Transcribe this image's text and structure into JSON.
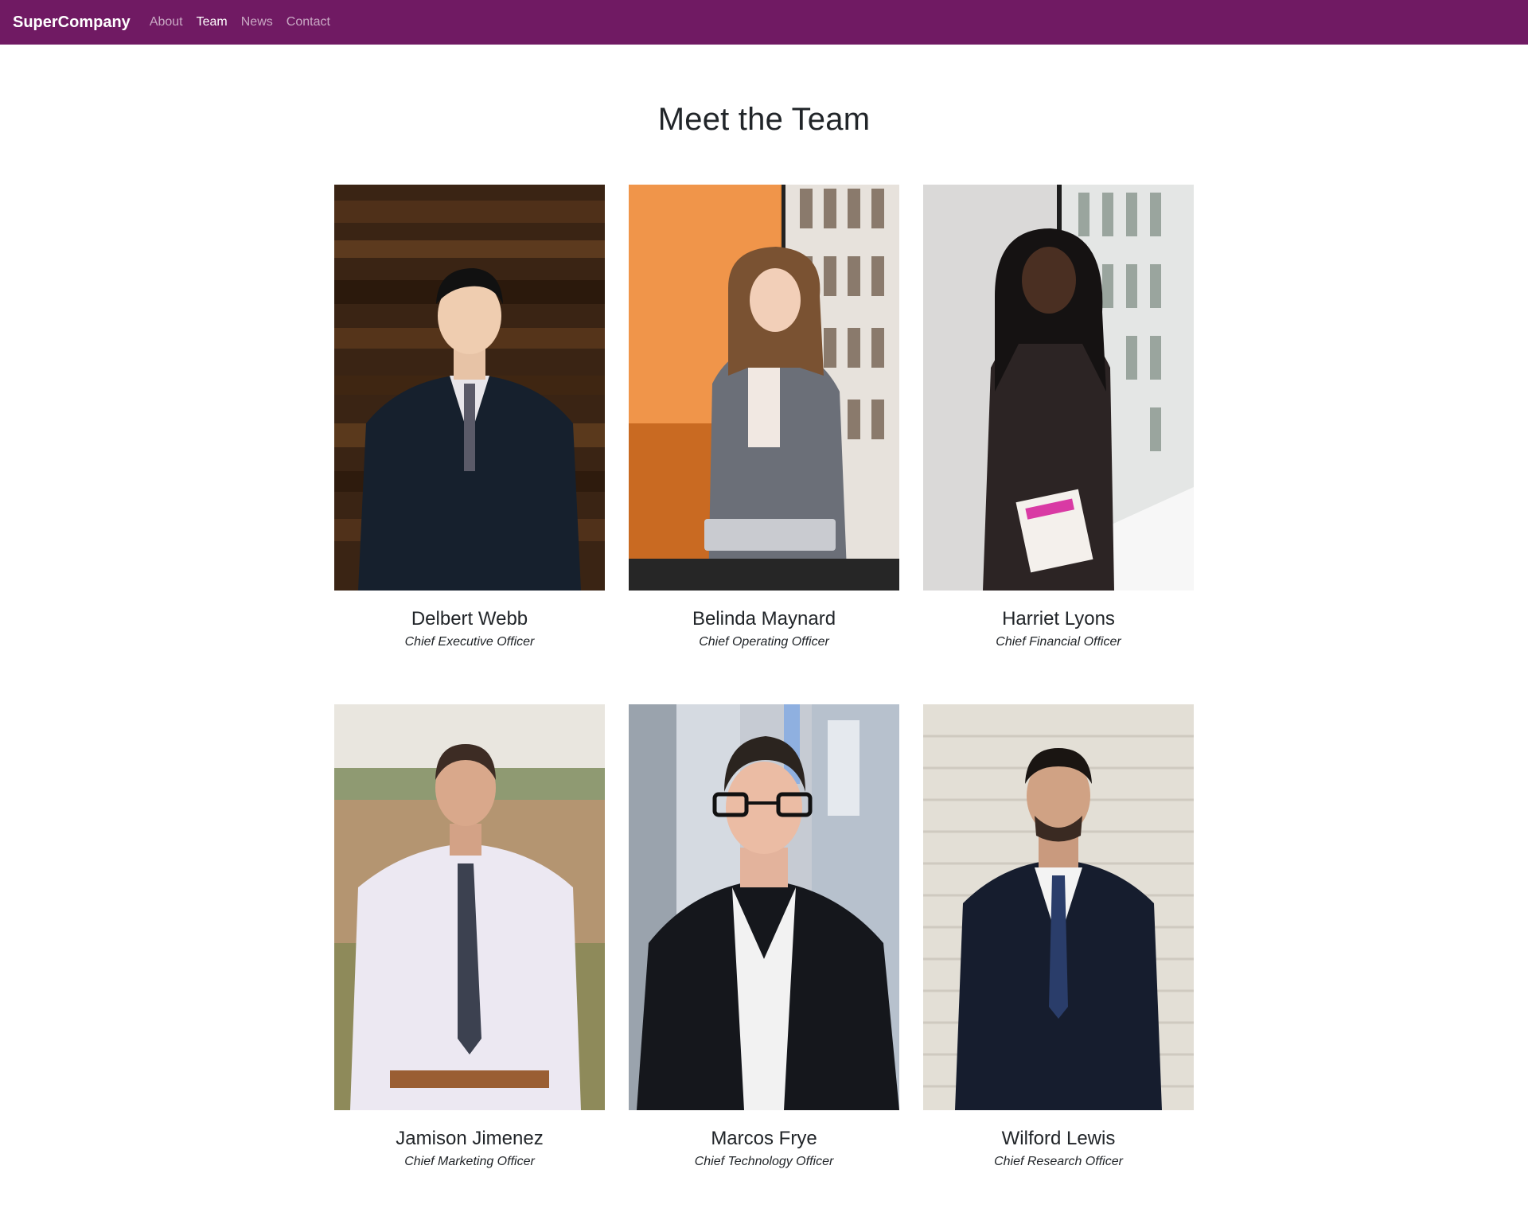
{
  "navbar": {
    "brand": "SuperCompany",
    "links": [
      {
        "label": "About",
        "active": false
      },
      {
        "label": "Team",
        "active": true
      },
      {
        "label": "News",
        "active": false
      },
      {
        "label": "Contact",
        "active": false
      }
    ],
    "background_color": "#701a63"
  },
  "main": {
    "title": "Meet the Team",
    "members": [
      {
        "name": "Delbert Webb",
        "role": "Chief Executive Officer"
      },
      {
        "name": "Belinda Maynard",
        "role": "Chief Operating Officer"
      },
      {
        "name": "Harriet Lyons",
        "role": "Chief Financial Officer"
      },
      {
        "name": "Jamison Jimenez",
        "role": "Chief Marketing Officer"
      },
      {
        "name": "Marcos Frye",
        "role": "Chief Technology Officer"
      },
      {
        "name": "Wilford Lewis",
        "role": "Chief Research Officer"
      }
    ]
  }
}
